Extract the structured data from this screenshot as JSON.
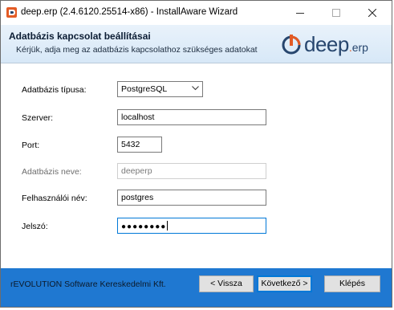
{
  "window": {
    "title": "deep.erp (2.4.6120.25514-x86) - InstallAware Wizard",
    "icon": "deeperp-app-icon"
  },
  "header": {
    "title": "Adatbázis kapcsolat beállításai",
    "subtitle": "Kérjük, adja meg az adatbázis kapcsolathoz szükséges adatokat",
    "logo": {
      "main": "deep",
      "dot": ".",
      "suffix": "erp"
    }
  },
  "colors": {
    "header_bg": "#dbe9f7",
    "footer_bg": "#1f78d1",
    "logo_blue": "#27466e",
    "logo_orange": "#e35b25",
    "focus_border": "#0078d7"
  },
  "form": {
    "db_type": {
      "label": "Adatbázis típusa:",
      "value": "PostgreSQL"
    },
    "server": {
      "label": "Szerver:",
      "value": "localhost"
    },
    "port": {
      "label": "Port:",
      "value": "5432"
    },
    "db_name": {
      "label": "Adatbázis neve:",
      "value": "deeperp",
      "disabled": true
    },
    "username": {
      "label": "Felhasználói név:",
      "value": "postgres"
    },
    "password": {
      "label": "Jelszó:",
      "value": "●●●●●●●●",
      "focused": true
    }
  },
  "footer": {
    "company": "rEVOLUTION Software Kereskedelmi Kft.",
    "back_label": "< Vissza",
    "next_label": "Következő >",
    "install_label": "Klépés"
  }
}
